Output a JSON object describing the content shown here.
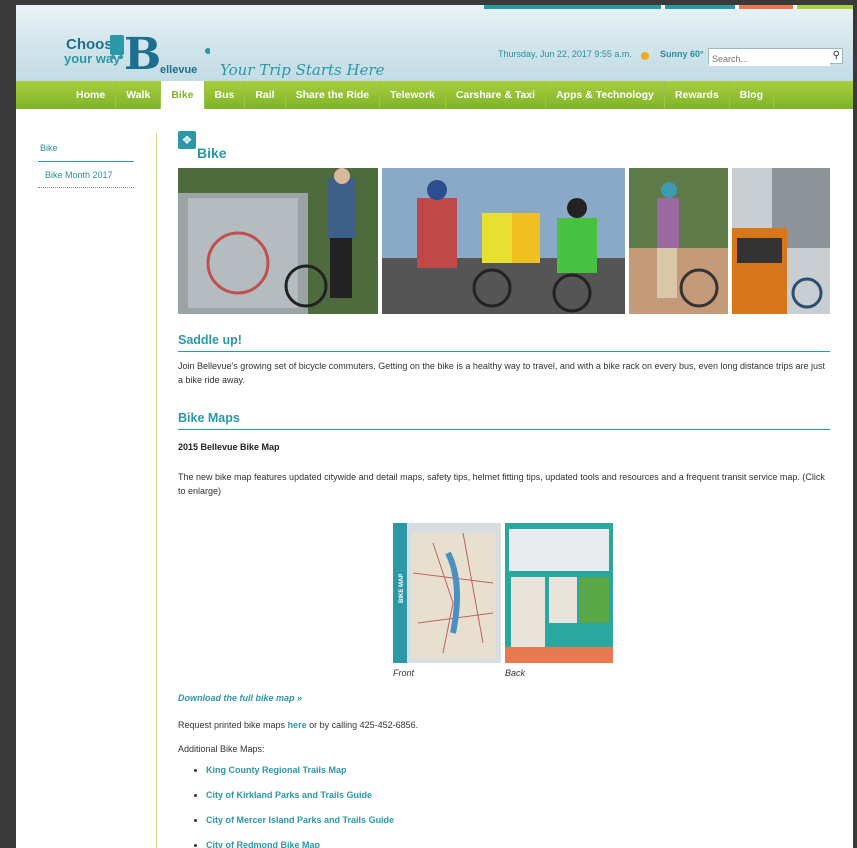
{
  "colors": {
    "teal": "#2a98a6",
    "green": "#8bbf31",
    "stripe_teal": "#2a98a6",
    "stripe_orange": "#e8794f",
    "stripe_green": "#a8cf3c"
  },
  "header": {
    "logo_text_top": "Choose",
    "logo_text_bottom": "your way",
    "logo_letter": "B",
    "logo_word": "ellevue",
    "tagline": "Your Trip Starts Here",
    "datetime": "Thursday, Jun 22, 2017 9:55 a.m.",
    "weather": "Sunny 60°",
    "search_placeholder": "Search..."
  },
  "nav": [
    "Home",
    "Walk",
    "Bike",
    "Bus",
    "Rail",
    "Share the Ride",
    "Telework",
    "Carshare & Taxi",
    "Apps & Technology",
    "Rewards",
    "Blog"
  ],
  "nav_active": "Bike",
  "sidebar": {
    "items": [
      {
        "label": "Bike"
      },
      {
        "label": "Bike Month 2017"
      }
    ]
  },
  "main": {
    "title": "Bike",
    "section1_title": "Saddle up!",
    "section1_text": "Join Bellevue's growing set of bicycle commuters. Getting on the bike is a healthy way to travel, and with a bike rack on every bus, even long distance trips are just a bike ride away.",
    "section2_title": "Bike Maps",
    "map_heading": "2015 Bellevue Bike Map",
    "map_text": "The new bike map features updated citywide and detail maps, safety tips, helmet fitting tips, updated tools and resources and a frequent transit service map. (Click to enlarge)",
    "map_front": "Front",
    "map_back": "Back",
    "map_strip_text": "BIKE MAP",
    "download_link": "Download the full bike map »",
    "request_prefix": "Request printed bike maps ",
    "request_link": "here",
    "request_suffix": " or by calling 425-452-6856.",
    "additional_label": "Additional Bike Maps:",
    "links": [
      "King County Regional Trails Map",
      "City of Kirkland Parks and Trails Guide",
      "City of Mercer Island Parks and Trails Guide",
      "City of Redmond Bike Map"
    ]
  }
}
